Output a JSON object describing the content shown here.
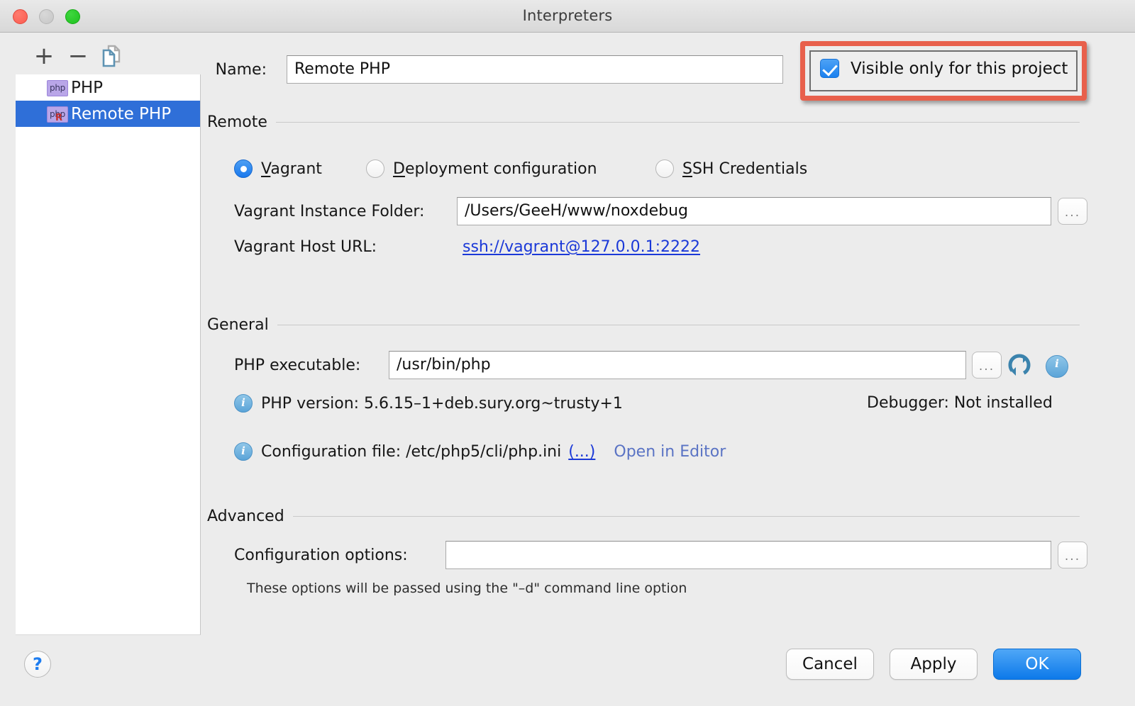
{
  "window": {
    "title": "Interpreters",
    "traffic_lights": [
      "close",
      "minimize",
      "maximize"
    ]
  },
  "sidebar": {
    "toolbar": [
      {
        "name": "add-interpreter",
        "glyph": "+"
      },
      {
        "name": "remove-interpreter",
        "glyph": "−"
      },
      {
        "name": "copy-interpreter",
        "glyph": "copy"
      }
    ],
    "items": [
      {
        "label": "PHP",
        "icon": "php-icon",
        "selected": false,
        "badge": ""
      },
      {
        "label": "Remote PHP",
        "icon": "php-remote-icon",
        "selected": true,
        "badge": "R"
      }
    ]
  },
  "form": {
    "name_label": "Name:",
    "name_value": "Remote PHP",
    "visible_only_checkbox": {
      "label": "Visible only for this project",
      "checked": true,
      "highlighted": true,
      "highlight_color": "#e8604c"
    }
  },
  "remote_section": {
    "title": "Remote",
    "radios": [
      {
        "label": "Vagrant",
        "mnemonic": "V",
        "selected": true
      },
      {
        "label": "Deployment configuration",
        "mnemonic": "D",
        "selected": false
      },
      {
        "label": "SSH Credentials",
        "mnemonic": "S",
        "selected": false
      }
    ],
    "instance_folder_label": "Vagrant Instance Folder:",
    "instance_folder_value": "/Users/GeeH/www/noxdebug",
    "host_url_label": "Vagrant Host URL:",
    "host_url_value": "ssh://vagrant@127.0.0.1:2222",
    "browse_label": "..."
  },
  "general_section": {
    "title": "General",
    "executable_label": "PHP executable:",
    "executable_value": "/usr/bin/php",
    "browse_label": "...",
    "refresh_icon": "refresh-icon",
    "info_icon": "info-icon",
    "php_version_text": "PHP version: 5.6.15–1+deb.sury.org~trusty+1",
    "debugger_text": "Debugger: Not installed",
    "config_file_text": "Configuration file: /etc/php5/cli/php.ini",
    "config_file_link": "(...)",
    "open_in_editor_link": "Open in Editor"
  },
  "advanced_section": {
    "title": "Advanced",
    "config_options_label": "Configuration options:",
    "config_options_value": "",
    "browse_label": "...",
    "hint": "These options will be passed using the \"–d\" command line option"
  },
  "footer": {
    "help_label": "?",
    "cancel_label": "Cancel",
    "apply_label": "Apply",
    "ok_label": "OK"
  },
  "colors": {
    "accent_blue": "#1b81ef",
    "selection_blue": "#2f6fd8",
    "link_blue": "#1b39d8",
    "highlight_red": "#e8604c",
    "window_bg": "#ececec"
  }
}
